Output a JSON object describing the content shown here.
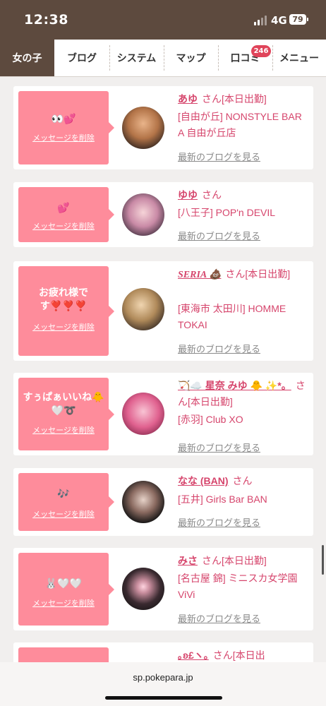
{
  "status_bar": {
    "time": "12:38",
    "network": "4G",
    "battery": "79"
  },
  "nav": {
    "tabs": [
      {
        "label": "女の子",
        "active": true
      },
      {
        "label": "ブログ"
      },
      {
        "label": "システム"
      },
      {
        "label": "マップ"
      },
      {
        "label": "口コミ",
        "badge": "246"
      },
      {
        "label": "メニュー"
      }
    ]
  },
  "delete_label": "メッセージを削除",
  "blog_link_label": "最新のブログを見る",
  "cards": [
    {
      "message": "👀💕",
      "name": "あゆ",
      "suffix": "さん[本日出勤]",
      "shop": "[自由が丘] NONSTYLE BAR A 自由が丘店"
    },
    {
      "message": "💕",
      "name": "ゆゆ",
      "suffix": "さん",
      "shop": "[八王子] POP'n DEVIL"
    },
    {
      "message": "お疲れ様です❣️❣️❣️",
      "name": "SERIA 💩",
      "suffix": "さん[本日出勤]",
      "shop": "[東海市 太田川] HOMME TOKAI"
    },
    {
      "message": "すぅぱぁいいね🐥🤍➰",
      "name": "🏹☁️ 星奈 みゆ 🐥 ✨*。",
      "suffix": "さん[本日出勤]",
      "shop": "[赤羽] Club XO"
    },
    {
      "message": "🎶",
      "name": "なな (BAN)",
      "suffix": "さん",
      "shop": "[五井] Girls Bar BAN"
    },
    {
      "message": "🐰🤍🤍",
      "name": "みさ",
      "suffix": "さん[本日出勤]",
      "shop": "[名古屋 錦] ミニスカ女学園ViVi"
    },
    {
      "message": "",
      "name": "｡ʚ£ヽ｡",
      "suffix": "さん[本日出",
      "shop": ""
    }
  ],
  "browser": {
    "url": "sp.pokepara.jp"
  },
  "colors": {
    "header_brown": "#5d4a3e",
    "message_pink": "#fe8c9b",
    "name_pink": "#d6456c",
    "badge_red": "#e0445a"
  }
}
